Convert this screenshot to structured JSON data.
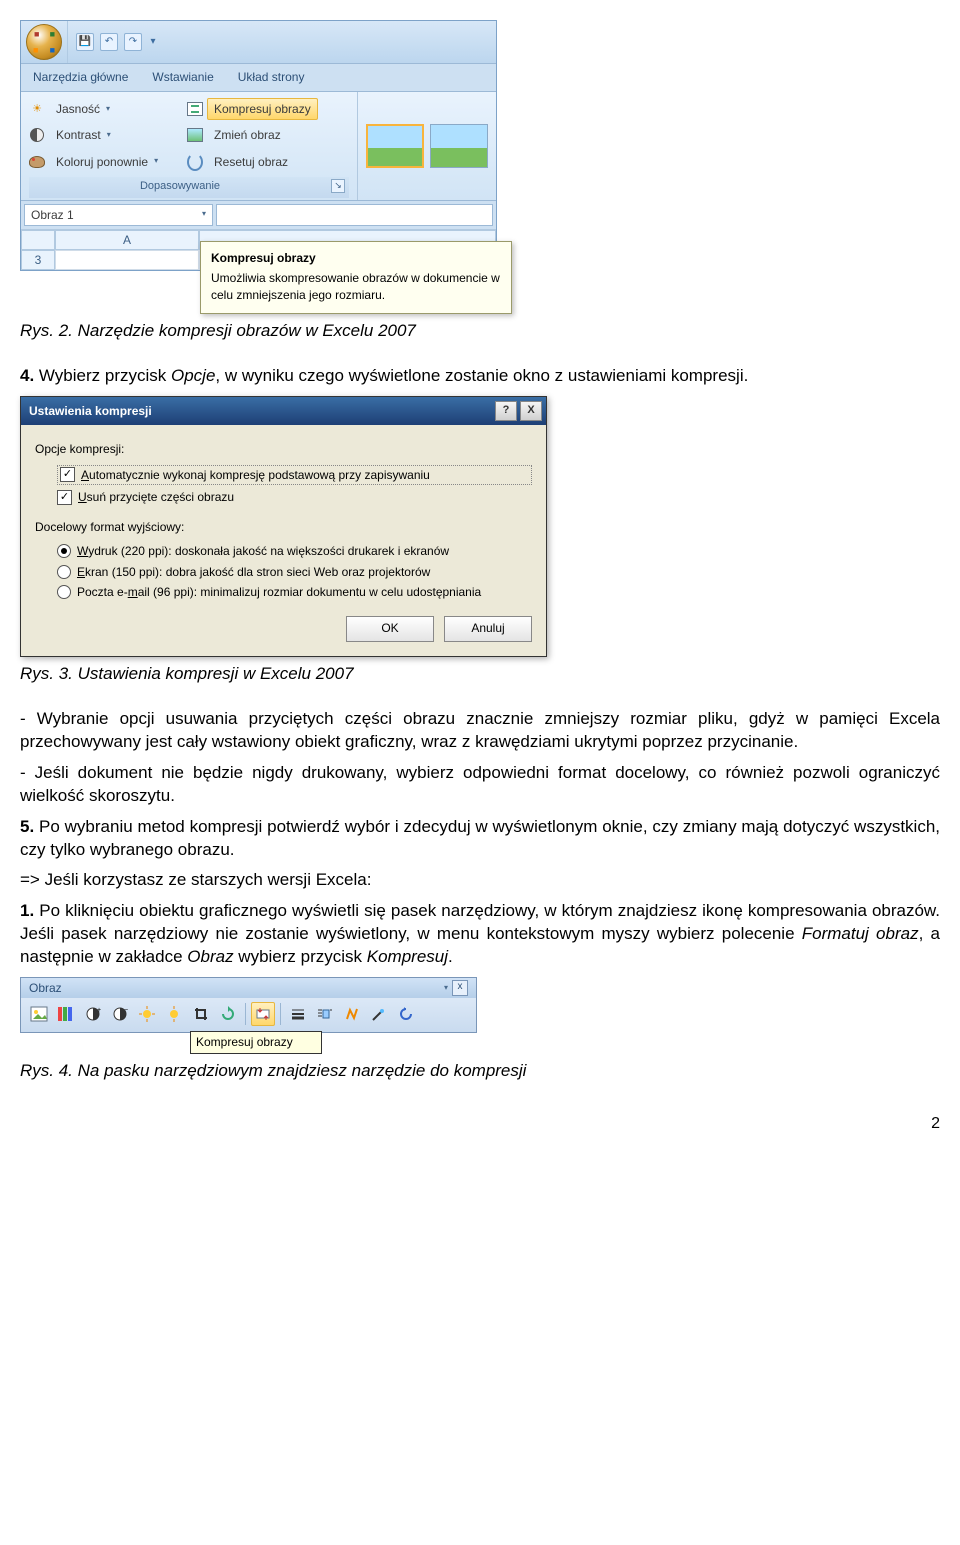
{
  "ribbon": {
    "qat": {
      "save": "💾",
      "undo": "↶",
      "redo": "↷",
      "dd": "▾"
    },
    "tabs": {
      "home": "Narzędzia główne",
      "insert": "Wstawianie",
      "layout": "Układ strony"
    },
    "adjust": {
      "brightness": "Jasność",
      "brightness_dd": "▾",
      "contrast": "Kontrast",
      "contrast_dd": "▾",
      "recolor": "Koloruj ponownie",
      "recolor_dd": "▾",
      "compress": "Kompresuj obrazy",
      "change": "Zmień obraz",
      "reset": "Resetuj obraz",
      "group_label": "Dopasowywanie",
      "expander": "↘"
    },
    "namebox": "Obraz 1",
    "namebox_dd": "▾",
    "col_a": "A",
    "row_3": "3",
    "tooltip_title": "Kompresuj obrazy",
    "tooltip_body": "Umożliwia skompresowanie obrazów w dokumencie w celu zmniejszenia jego rozmiaru."
  },
  "caption1": "Rys. 2. Narzędzie kompresji obrazów w Excelu 2007",
  "para1_a": "4.",
  "para1_b": " Wybierz przycisk ",
  "para1_c": "Opcje",
  "para1_d": ", w wyniku czego wyświetlone zostanie okno z ustawieniami kompresji.",
  "dialog": {
    "title": "Ustawienia kompresji",
    "help": "?",
    "close": "X",
    "sec1": "Opcje kompresji:",
    "cb1_pre": "",
    "cb1_u": "A",
    "cb1_post": "utomatycznie wykonaj kompresję podstawową przy zapisywaniu",
    "cb2_pre": "",
    "cb2_u": "U",
    "cb2_post": "suń przycięte części obrazu",
    "sec2": "Docelowy format wyjściowy:",
    "rb1_u": "W",
    "rb1_post": "ydruk (220 ppi): doskonała jakość na większości drukarek i ekranów",
    "rb2_u": "E",
    "rb2_post": "kran (150 ppi): dobra jakość dla stron sieci Web oraz projektorów",
    "rb3_pre": "Poczta e-",
    "rb3_u": "m",
    "rb3_post": "ail (96 ppi): minimalizuj rozmiar dokumentu w celu udostępniania",
    "ok": "OK",
    "cancel": "Anuluj"
  },
  "caption2": "Rys. 3. Ustawienia kompresji w Excelu 2007",
  "para2": "- Wybranie opcji usuwania przyciętych części obrazu znacznie zmniejszy rozmiar pliku, gdyż w pamięci Excela przechowywany jest cały wstawiony obiekt graficzny, wraz z krawędziami ukrytymi poprzez przycinanie.",
  "para3": "- Jeśli dokument nie będzie nigdy drukowany, wybierz odpowiedni format docelowy, co również pozwoli ograniczyć wielkość skoroszytu.",
  "para4_a": "5.",
  "para4_b": " Po wybraniu metod kompresji potwierdź wybór i zdecyduj w wyświetlonym oknie, czy zmiany mają dotyczyć wszystkich, czy tylko wybranego obrazu.",
  "para5": "=> Jeśli korzystasz ze starszych wersji Excela:",
  "para6_a": "1.",
  "para6_b": " Po kliknięciu obiektu graficznego wyświetli się pasek narzędziowy, w którym znajdziesz ikonę kompresowania obrazów. Jeśli pasek narzędziowy nie zostanie wyświetlony, w menu kontekstowym myszy wybierz polecenie ",
  "para6_c": "Formatuj obraz",
  "para6_d": ", a następnie w zakładce ",
  "para6_e": "Obraz",
  "para6_f": " wybierz przycisk ",
  "para6_g": "Kompresuj",
  "para6_h": ".",
  "toolbar": {
    "title": "Obraz",
    "dd": "▾",
    "close": "x",
    "tooltip": "Kompresuj obrazy"
  },
  "caption3": "Rys. 4. Na pasku narzędziowym znajdziesz narzędzie do kompresji",
  "pagenum": "2"
}
